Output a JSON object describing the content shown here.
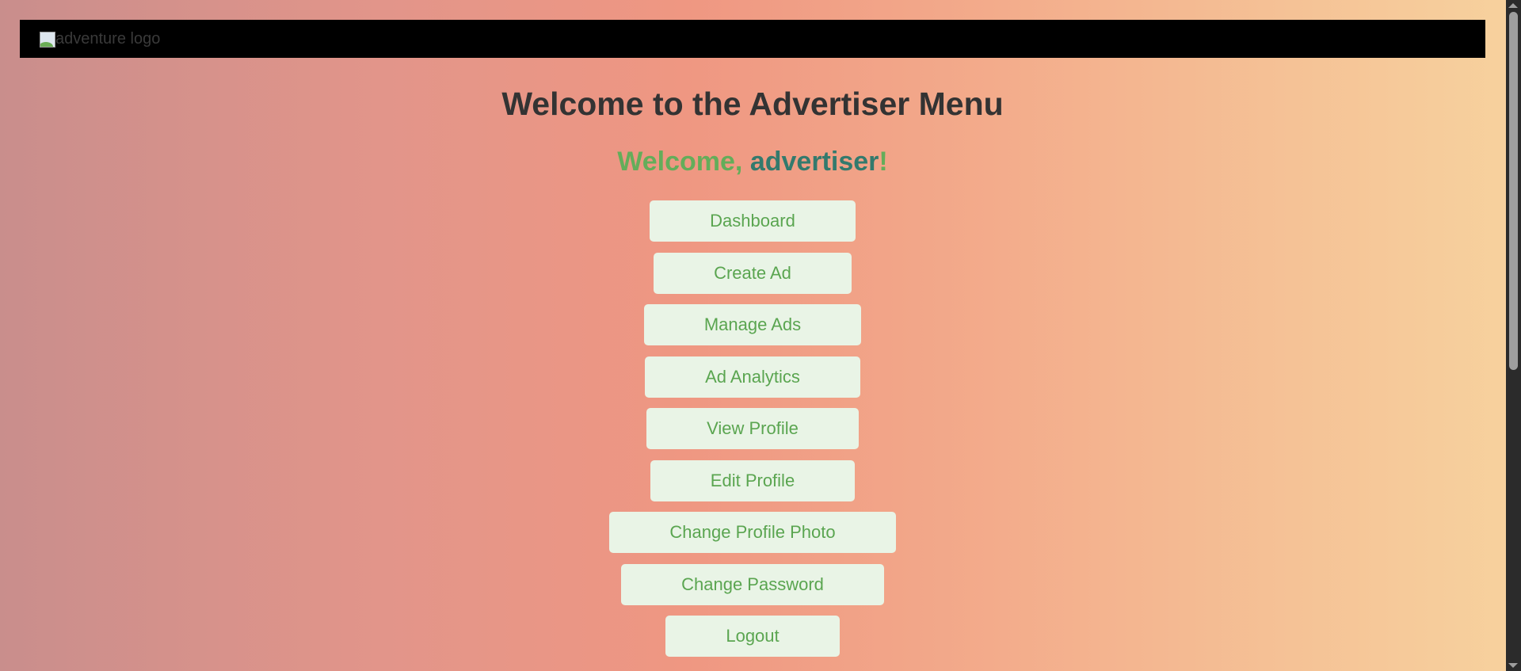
{
  "header": {
    "logo_alt": "adventure logo"
  },
  "title": "Welcome to the Advertiser Menu",
  "welcome": {
    "prefix": "Welcome, ",
    "username": "advertiser",
    "suffix": "!"
  },
  "menu": [
    {
      "label": "Dashboard"
    },
    {
      "label": "Create Ad"
    },
    {
      "label": "Manage Ads"
    },
    {
      "label": "Ad Analytics"
    },
    {
      "label": "View Profile"
    },
    {
      "label": "Edit Profile"
    },
    {
      "label": "Change Profile Photo"
    },
    {
      "label": "Change Password"
    },
    {
      "label": "Logout"
    }
  ],
  "colors": {
    "header_bg": "#000000",
    "button_bg": "#e9f4e6",
    "button_text": "#5aa550",
    "username": "#337a6d",
    "title": "#333333"
  }
}
